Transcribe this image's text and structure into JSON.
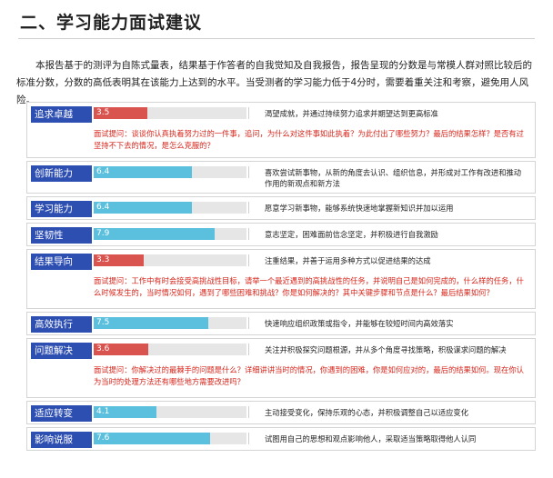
{
  "title": "二、学习能力面试建议",
  "intro": "本报告基于的测评为自陈式量表，结果基于作答者的自我觉知及自我报告，报告呈现的分数是与常模人群对照比较后的标准分数，分数的高低表明其在该能力上达到的水平。当受测者的学习能力低于4分时，需要着重关注和考察，避免用人风险。",
  "colors": {
    "label_bg": "#2e4fb2",
    "bar_low": "#d9534f",
    "bar_high": "#5bc0de",
    "question": "#d8251b"
  },
  "scale_max": 10,
  "items": [
    {
      "label": "追求卓越",
      "score": "3.5",
      "value": 3.5,
      "status": "low",
      "desc": "渴望成就，并通过持续努力追求并期望达到更高标准",
      "question": "面试提问：谈谈你认真执着努力过的一件事，追问，为什么对这件事如此执着？为此付出了哪些努力？最后的结果怎样？是否有过坚持不下去的情况，是怎么克服的？"
    },
    {
      "label": "创新能力",
      "score": "6.4",
      "value": 6.4,
      "status": "high",
      "desc": "喜欢尝试新事物，从新的角度去认识、组织信息，并形成对工作有改进和推动作用的新观点和新方法",
      "question": ""
    },
    {
      "label": "学习能力",
      "score": "6.4",
      "value": 6.4,
      "status": "high",
      "desc": "愿意学习新事物，能够系统快速地掌握新知识并加以运用",
      "question": ""
    },
    {
      "label": "坚韧性",
      "score": "7.9",
      "value": 7.9,
      "status": "high",
      "desc": "意志坚定，困难面前信念坚定，并积极进行自我激励",
      "question": ""
    },
    {
      "label": "结果导向",
      "score": "3.3",
      "value": 3.3,
      "status": "low",
      "desc": "注重结果，并善于运用多种方式以促进结果的达成",
      "question": "面试提问：工作中有时会接受高挑战性目标，请举一个最近遇到的高挑战性的任务，并说明自己是如何完成的，什么样的任务，什么时候发生的，当时情况如何，遇到了哪些困难和挑战？你是如何解决的？其中关键步骤和节点是什么？最后结果如何？"
    },
    {
      "label": "高效执行",
      "score": "7.5",
      "value": 7.5,
      "status": "high",
      "desc": "快速响应组织政策或指令，并能够在较短时间内高效落实",
      "question": ""
    },
    {
      "label": "问题解决",
      "score": "3.6",
      "value": 3.6,
      "status": "low",
      "desc": "关注并积极探究问题根源，并从多个角度寻找策略，积极谋求问题的解决",
      "question": "面试提问：你解决过的最棘手的问题是什么？详细讲讲当时的情况，你遇到的困难，你是如何应对的，最后的结果如何。现在你认为当时的处理方法还有哪些地方需要改进吗？"
    },
    {
      "label": "适应转变",
      "score": "4.1",
      "value": 4.1,
      "status": "high",
      "desc": "主动接受变化，保持乐观的心态，并积极调整自己以适应变化",
      "question": ""
    },
    {
      "label": "影响说服",
      "score": "7.6",
      "value": 7.6,
      "status": "high",
      "desc": "试图用自己的思想和观点影响他人，采取适当策略取得他人认同",
      "question": ""
    }
  ]
}
